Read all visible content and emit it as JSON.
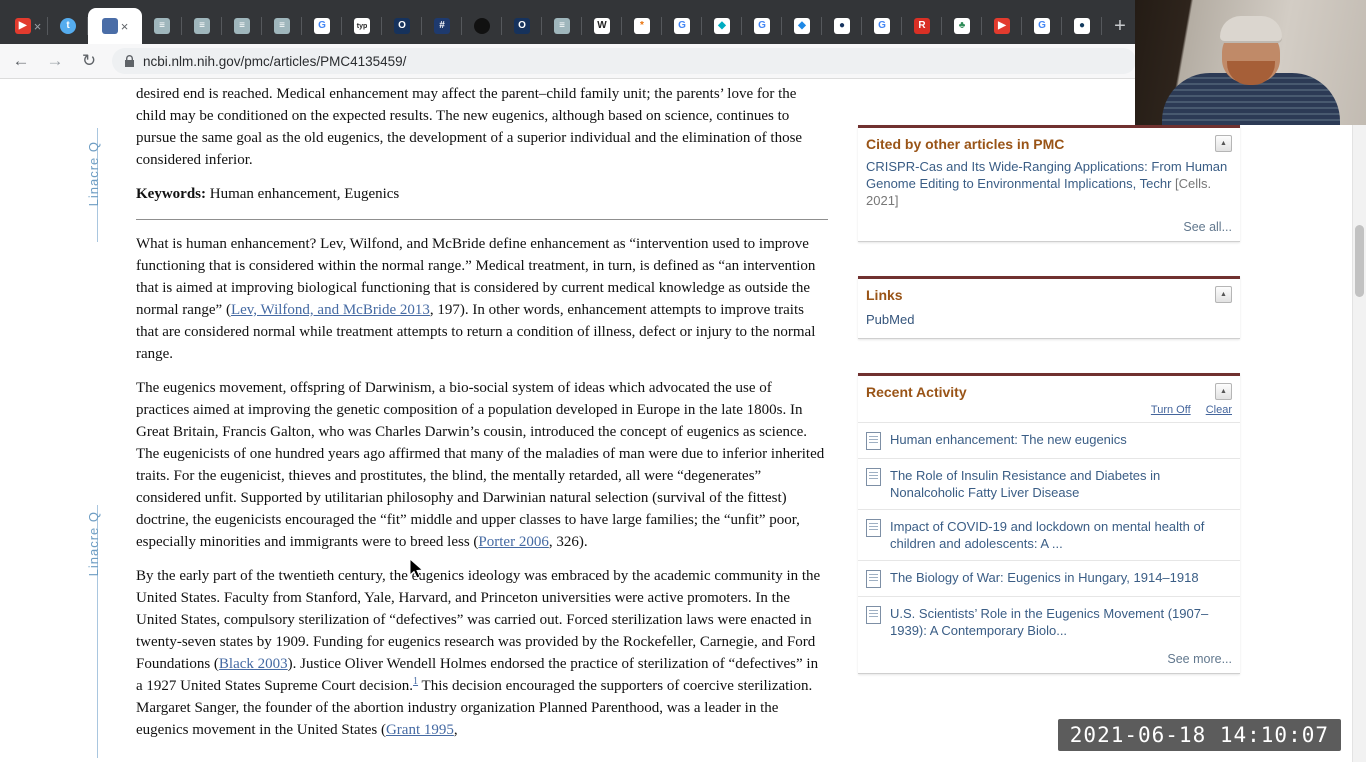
{
  "browser": {
    "url": "ncbi.nlm.nih.gov/pmc/articles/PMC4135459/",
    "new_tab_label": "+",
    "nav": {
      "back": "←",
      "forward": "→",
      "reload": "↻"
    },
    "tabs": [
      {
        "name": "youtube-tab",
        "icon": "youtube-icon",
        "glyph": "▶",
        "bg": "#e23b2e",
        "fg": "#ffffff",
        "close": true
      },
      {
        "name": "twitter-tab",
        "icon": "twitter-icon",
        "glyph": "t",
        "bg": "#55acee",
        "fg": "#ffffff",
        "round": true
      },
      {
        "name": "pmc-article-tab",
        "icon": "ncbi-icon",
        "glyph": "",
        "bg": "#4a6da7",
        "fg": "#ffffff",
        "active": true,
        "close": true
      },
      {
        "name": "docs-tab-1",
        "icon": "document-icon",
        "glyph": "≡",
        "bg": "#9fb6bc",
        "fg": "#ffffff"
      },
      {
        "name": "docs-tab-2",
        "icon": "document-icon",
        "glyph": "≡",
        "bg": "#9fb6bc",
        "fg": "#ffffff"
      },
      {
        "name": "docs-tab-3",
        "icon": "document-icon",
        "glyph": "≡",
        "bg": "#9fb6bc",
        "fg": "#ffffff"
      },
      {
        "name": "docs-tab-4",
        "icon": "document-icon",
        "glyph": "≡",
        "bg": "#9fb6bc",
        "fg": "#ffffff"
      },
      {
        "name": "google-tab-1",
        "icon": "google-icon",
        "glyph": "G",
        "bg": "#ffffff",
        "fg": "#4285f4"
      },
      {
        "name": "typ-tab",
        "icon": "typ-icon",
        "glyph": "typ",
        "bg": "#ffffff",
        "fg": "#222222"
      },
      {
        "name": "o-site-tab-1",
        "icon": "o-icon",
        "glyph": "O",
        "bg": "#16325c",
        "fg": "#ffffff"
      },
      {
        "name": "grid-tab",
        "icon": "grid-icon",
        "glyph": "#",
        "bg": "#1e3a6e",
        "fg": "#ffffff"
      },
      {
        "name": "obsidian-tab",
        "icon": "black-circle-icon",
        "glyph": "",
        "bg": "#111111",
        "fg": "#ffffff",
        "round": true
      },
      {
        "name": "o-site-tab-2",
        "icon": "o-icon",
        "glyph": "O",
        "bg": "#16325c",
        "fg": "#ffffff"
      },
      {
        "name": "docs-tab-5",
        "icon": "document-icon",
        "glyph": "≡",
        "bg": "#9fb6bc",
        "fg": "#ffffff"
      },
      {
        "name": "wikipedia-tab",
        "icon": "wikipedia-icon",
        "glyph": "W",
        "bg": "#ffffff",
        "fg": "#222222"
      },
      {
        "name": "flower-tab",
        "icon": "flower-icon",
        "glyph": "*",
        "bg": "#ffffff",
        "fg": "#e8710a"
      },
      {
        "name": "google-tab-2",
        "icon": "google-icon",
        "glyph": "G",
        "bg": "#ffffff",
        "fg": "#4285f4"
      },
      {
        "name": "drive-tab-1",
        "icon": "teal-diamond-icon",
        "glyph": "◆",
        "bg": "#ffffff",
        "fg": "#00acc1"
      },
      {
        "name": "google-tab-3",
        "icon": "google-icon",
        "glyph": "G",
        "bg": "#ffffff",
        "fg": "#4285f4"
      },
      {
        "name": "drive-tab-2",
        "icon": "blue-diamond-icon",
        "glyph": "◆",
        "bg": "#ffffff",
        "fg": "#1e88e5"
      },
      {
        "name": "navy-circle-tab",
        "icon": "navy-circle-icon",
        "glyph": "●",
        "bg": "#ffffff",
        "fg": "#16335f"
      },
      {
        "name": "google-tab-4",
        "icon": "google-icon",
        "glyph": "G",
        "bg": "#ffffff",
        "fg": "#4285f4"
      },
      {
        "name": "r-site-tab",
        "icon": "r-icon",
        "glyph": "R",
        "bg": "#d93025",
        "fg": "#ffffff"
      },
      {
        "name": "plant-tab",
        "icon": "plant-icon",
        "glyph": "♣",
        "bg": "#ffffff",
        "fg": "#2e8b57"
      },
      {
        "name": "youtube-tab-2",
        "icon": "youtube-icon",
        "glyph": "▶",
        "bg": "#e23b2e",
        "fg": "#ffffff"
      },
      {
        "name": "google-tab-5",
        "icon": "google-icon",
        "glyph": "G",
        "bg": "#ffffff",
        "fg": "#4285f4"
      },
      {
        "name": "globe-tab",
        "icon": "globe-icon",
        "glyph": "●",
        "bg": "#ffffff",
        "fg": "#123a5e"
      }
    ]
  },
  "article": {
    "margin_label": "Linacre Q",
    "intro": [
      {
        "t": "desired end is reached. Medical enhancement may affect the parent–child family unit; the parents’ love for the child may be conditioned on the expected results. The new eugenics, although based on science, continues to pursue the same goal as the old eugenics, the development of a superior individual and the elimination of those considered inferior."
      }
    ],
    "keywords_label": "Keywords:",
    "keywords_value": " Human enhancement, Eugenics",
    "paragraphs": [
      [
        {
          "t": "What is human enhancement? Lev, Wilfond, and McBride define enhancement as “intervention used to improve functioning that is considered within the normal range.” Medical treatment, in turn, is defined as “an intervention that is aimed at improving biological functioning that is considered by current medical knowledge as outside the normal range” ("
        },
        {
          "t": "Lev, Wilfond, and McBride 2013",
          "link": true
        },
        {
          "t": ", 197). In other words, enhancement attempts to improve traits that are considered normal while treatment attempts to return a condition of illness, defect or injury to the normal range."
        }
      ],
      [
        {
          "t": "The eugenics movement, offspring of Darwinism, a bio-social system of ideas which advocated the use of practices aimed at improving the genetic composition of a population developed in Europe in the late 1800s. In Great Britain, Francis Galton, who was Charles Darwin’s cousin, introduced the concept of eugenics as science. The eugenicists of one hundred years ago affirmed that many of the maladies of man were due to inferior inherited traits. For the eugenicist, thieves and prostitutes, the blind, the mentally retarded, all were “degenerates” considered unfit. Supported by utilitarian philosophy and Darwinian natural selection (survival of the fittest) doctrine, the eugenicists encouraged the “fit” middle and upper classes to have large families; the “unfit” poor, especially minorities and immigrants were to breed less ("
        },
        {
          "t": "Porter 2006",
          "link": true
        },
        {
          "t": ", 326)."
        }
      ],
      [
        {
          "t": "By the early part of the twentieth century, the eugenics ideology was embraced by the academic community in the United States. Faculty from Stanford, Yale, Harvard, and Princeton universities were active promoters. In the United States, compulsory sterilization of “defectives” was carried out. Forced sterilization laws were enacted in twenty-seven states by 1909. Funding for eugenics research was provided by the Rockefeller, Carnegie, and Ford Foundations ("
        },
        {
          "t": "Black 2003",
          "link": true
        },
        {
          "t": "). Justice Oliver Wendell Holmes endorsed the practice of sterilization of “defectives” in a 1927 United States Supreme Court decision."
        },
        {
          "t": "1",
          "sup": true
        },
        {
          "t": " This decision encouraged the supporters of coercive sterilization. Margaret Sanger, the founder of the abortion industry organization Planned Parenthood, was a leader in the eugenics movement in the United States ("
        },
        {
          "t": "Grant 1995",
          "link": true
        },
        {
          "t": ","
        }
      ]
    ]
  },
  "sidebar": {
    "collapse_glyph": "▲",
    "cited_box": {
      "title": "Cited by other articles in PMC",
      "item_title": "CRISPR-Cas and Its Wide-Ranging Applications: From Human Genome Editing to Environmental Implications, Techr",
      "item_source": " [Cells. 2021]",
      "see_all": "See all..."
    },
    "links_box": {
      "title": "Links",
      "items": [
        "PubMed"
      ]
    },
    "recent_box": {
      "title": "Recent Activity",
      "turn_off": "Turn Off",
      "clear": "Clear",
      "items": [
        "Human enhancement: The new eugenics",
        "The Role of Insulin Resistance and Diabetes in Nonalcoholic Fatty Liver Disease",
        "Impact of COVID-19 and lockdown on mental health of children and adolescents: A ...",
        "The Biology of War: Eugenics in Hungary, 1914–1918",
        "U.S. Scientists’ Role in the Eugenics Movement (1907–1939): A Contemporary Biolo..."
      ],
      "see_more": "See more..."
    }
  },
  "overlays": {
    "timestamp": "2021-06-18 14:10:07"
  }
}
